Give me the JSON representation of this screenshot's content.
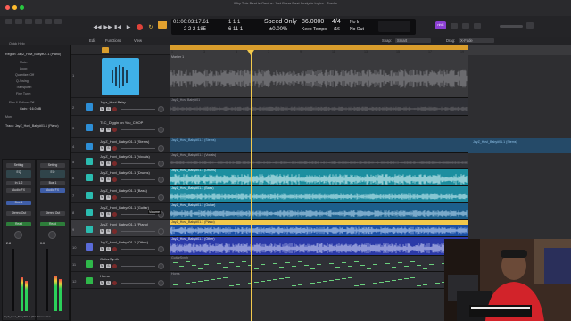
{
  "window": {
    "title": "Why This Beat is Genius: Just Blaze Beat Analysis.logicx - Tracks"
  },
  "lcd": {
    "bars_beats": "01:00:03:17.61",
    "bars_sub": "2  2  2  185",
    "pos_a": "1  1  1",
    "pos_b": "6  11  1",
    "speed_label": "Speed Only",
    "speed_value": "±0.00%",
    "tempo": "86.0000",
    "tempo_mode": "Keep Tempo",
    "sig_top": "4/4",
    "sig_bottom": "/16",
    "in_label": "No In",
    "out_label": "No Out",
    "account_badge": "nhC"
  },
  "toolbar": {
    "edit": "Edit",
    "functions": "Functions",
    "view": "View",
    "snap_label": "Snap:",
    "snap_value": "Smart",
    "drag_label": "Drag:",
    "drag_value": "X-Fade"
  },
  "inspector": {
    "quick_help": "Quick Help",
    "region_title": "Region: JayZ_Hovi_Baby#01.1 (Piano)",
    "params": [
      "Mute:",
      "Loop:",
      "Quantize: Off",
      "Q-Swing:",
      "Transpose:",
      "Fine Tune:",
      "Flex & Follow: Off",
      "Gain: +16.0 dB"
    ],
    "more": "More",
    "track_title": "Track: JayZ_Hovi_Baby#01.1 (Piano)",
    "strip_a": {
      "setting": "Setting",
      "eq": "EQ",
      "input": "In 1-2",
      "audio_fx": "Audio FX",
      "send": "Bus 1",
      "output": "Stereo Out",
      "group": "Read",
      "value": "2.8",
      "name": "JayZ_Hovi_Baby#01.1 (Piano)"
    },
    "strip_b": {
      "setting": "Setting",
      "eq": "EQ",
      "input": "Bus 1",
      "audio_fx": "Audio FX",
      "send": "",
      "output": "Stereo Out",
      "group": "Read",
      "value": "0.0",
      "name": "Stereo Out"
    }
  },
  "tracks": [
    {
      "num": "1",
      "name": "",
      "color": "#3aa8e0",
      "mute": "M",
      "solo": "S"
    },
    {
      "num": "2",
      "name": "Jayz_Hovi Baby",
      "color": "#2d8ed6",
      "mute": "M",
      "solo": "S"
    },
    {
      "num": "3",
      "name": "TLC_Diggin on You_CHOP",
      "color": "#2d8ed6",
      "mute": "M",
      "solo": "S"
    },
    {
      "num": "4",
      "name": "JayZ_Hovi_Baby#01.1 (Stems)",
      "color": "#2d8ed6",
      "mute": "M",
      "solo": "S"
    },
    {
      "num": "5",
      "name": "JayZ_Hovi_Baby#01.1 (Vocals)",
      "color": "#2bbcb0",
      "mute": "M",
      "solo": "S"
    },
    {
      "num": "6",
      "name": "JayZ_Hovi_Baby#01.1 (Drums)",
      "color": "#2bbcb0",
      "mute": "M",
      "solo": "S"
    },
    {
      "num": "7",
      "name": "JayZ_Hovi_Baby#01.1 (Bass)",
      "color": "#2bbcb0",
      "mute": "M",
      "solo": "S"
    },
    {
      "num": "8",
      "name": "JayZ_Hovi_Baby#01.1 (Guitar)",
      "color": "#2bbcb0",
      "mute": "M",
      "solo": "S"
    },
    {
      "num": "9",
      "name": "JayZ_Hovi_Baby#01.1 (Piano)",
      "color": "#2bbcb0",
      "mute": "M",
      "solo": "S"
    },
    {
      "num": "10",
      "name": "JayZ_Hovi_Baby#01.1 (Other)",
      "color": "#5a6bd8",
      "mute": "M",
      "solo": "S"
    },
    {
      "num": "11",
      "name": "GuitarSynth",
      "color": "#2fb84a",
      "mute": "M",
      "solo": "S"
    },
    {
      "num": "12",
      "name": "Horns",
      "color": "#2fb84a",
      "mute": "M",
      "solo": "S"
    }
  ],
  "volume_tooltip": "Volume",
  "regions": {
    "marker": "Marker 1",
    "r2": "JayZ_Hovi Baby#01",
    "r4": "JayZ_Hovi_Baby#01.1 (Stems)",
    "r4b": "JayZ_Hovi_Baby#01.1 (Stems)",
    "r5": "JayZ_Hovi_Baby#01.1 (Vocals)",
    "r6": "JayZ_Hovi_Baby#01.1 (Drums)",
    "r7": "JayZ_Hovi_Baby#01.1 (Bass)",
    "r8": "JayZ_Hovi_Baby#01.1 (Guitar)",
    "r9": "JayZ_Hovi_Baby#01.1 (Piano)",
    "r10": "JayZ_Hovi_Baby#01.1 (Other)",
    "r11": "GuitarSynth",
    "r12": "Horns"
  },
  "ruler_ticks": [
    "1",
    "3",
    "5",
    "7",
    "9",
    "11",
    "13",
    "15",
    "17",
    "19"
  ]
}
